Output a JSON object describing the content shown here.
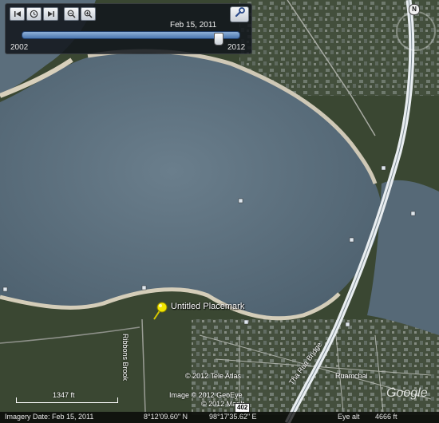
{
  "time_slider": {
    "current_date": "Feb 15, 2011",
    "start_year": "2002",
    "end_year": "2012",
    "position_fraction": 0.9,
    "buttons": [
      "skip-back-icon",
      "clock-icon",
      "skip-forward-icon",
      "zoom-out-icon",
      "zoom-in-icon"
    ],
    "settings_icon": "wrench-icon"
  },
  "navigation": {
    "north_label": "N",
    "compass_icon": "compass-ring-icon"
  },
  "placemark": {
    "label": "Untitled Placemark",
    "icon": "yellow-pushpin-icon",
    "color": "#f2e600"
  },
  "road_labels": {
    "ribbons": "Ribbons Brook",
    "highway": "Tha Rua Bridge",
    "ruamchai": "Ruamchai"
  },
  "copyright": {
    "tele_atlas": "© 2012 Tele Atlas",
    "geoeye": "Image © 2012 GeoEye",
    "mapit": "© 2012 MapIt",
    "route_shield": "402"
  },
  "brand": "Google",
  "scale": {
    "label": "1347 ft"
  },
  "status_bar": {
    "imagery_date": "Imagery Date: Feb 15, 2011",
    "latitude": "8°12'09.60\" N",
    "longitude": "98°17'35.62\" E",
    "eye_alt_label": "Eye alt",
    "eye_alt_value": "4666 ft"
  },
  "colors": {
    "water": "#566977",
    "land": "#3c4a34",
    "sand": "#c9c3b1",
    "bridge": "#e9eef1"
  }
}
